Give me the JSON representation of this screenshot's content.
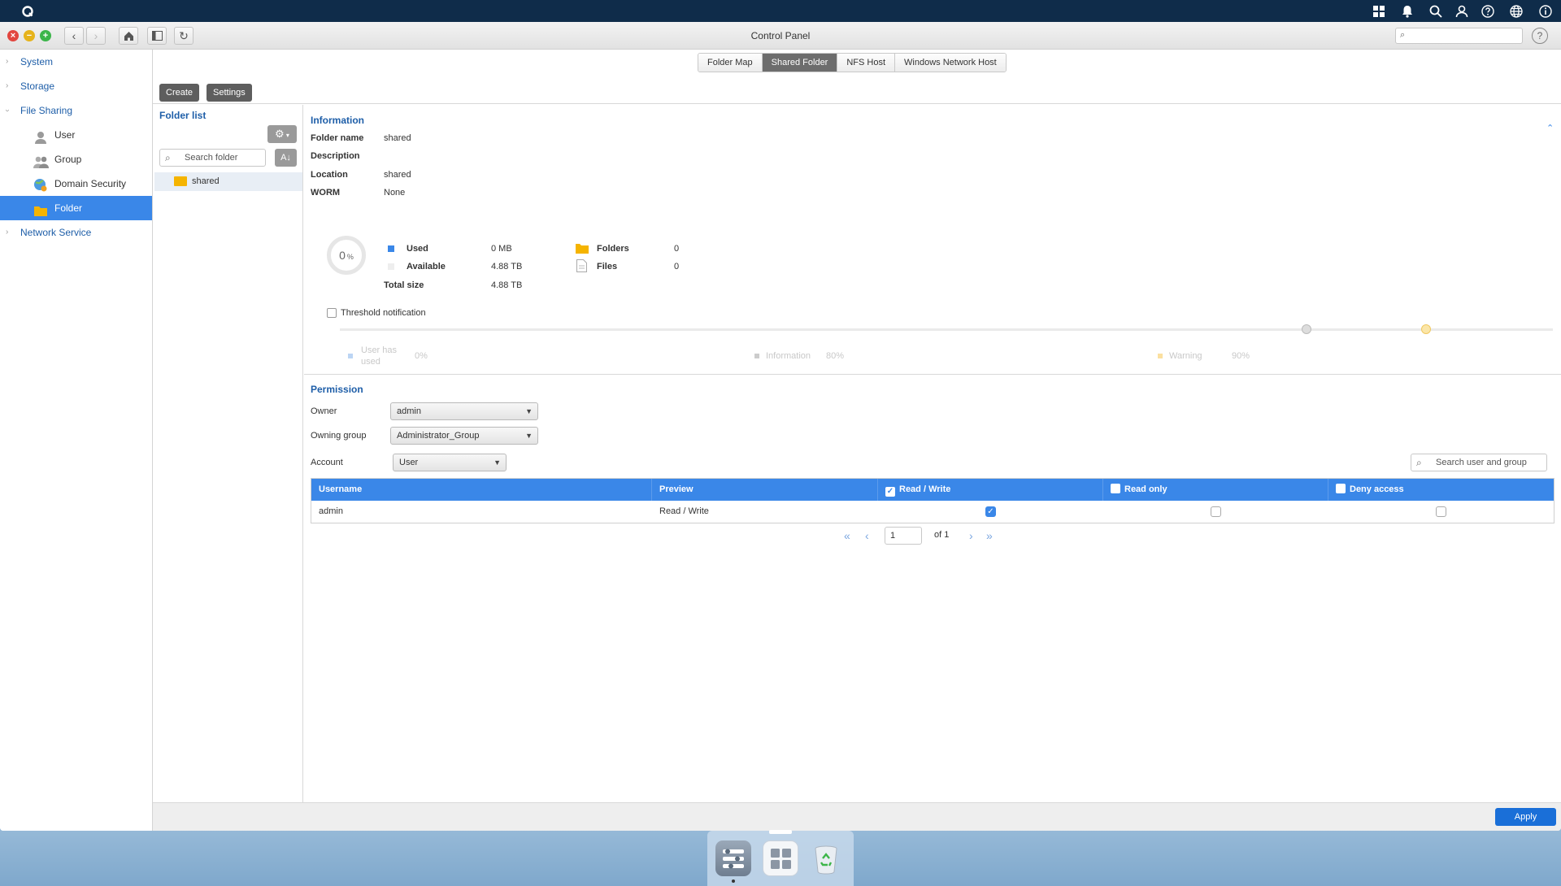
{
  "window": {
    "title": "Control Panel",
    "help_label": "?"
  },
  "sidebar": {
    "items": [
      {
        "label": "System"
      },
      {
        "label": "Storage"
      },
      {
        "label": "File Sharing"
      },
      {
        "label": "User"
      },
      {
        "label": "Group"
      },
      {
        "label": "Domain Security"
      },
      {
        "label": "Folder"
      },
      {
        "label": "Network Service"
      }
    ]
  },
  "tabs": [
    {
      "label": "Folder Map"
    },
    {
      "label": "Shared Folder"
    },
    {
      "label": "NFS Host"
    },
    {
      "label": "Windows Network Host"
    }
  ],
  "toolbar": {
    "create_label": "Create",
    "settings_label": "Settings"
  },
  "folder_panel": {
    "title": "Folder list",
    "search_placeholder": "Search folder",
    "folders": [
      {
        "name": "shared"
      }
    ]
  },
  "information": {
    "title": "Information",
    "fields": [
      {
        "label": "Folder name",
        "value": "shared"
      },
      {
        "label": "Description",
        "value": ""
      },
      {
        "label": "Location",
        "value": "shared"
      },
      {
        "label": "WORM",
        "value": "None"
      }
    ],
    "usage_percent": "0",
    "usage_unit": "%",
    "stats": [
      {
        "label": "Used",
        "value": "0 MB"
      },
      {
        "label": "Available",
        "value": "4.88 TB"
      },
      {
        "label": "Total size",
        "value": "4.88 TB"
      }
    ],
    "counts": [
      {
        "label": "Folders",
        "value": "0"
      },
      {
        "label": "Files",
        "value": "0"
      }
    ],
    "threshold_label": "Threshold notification",
    "threshold_legend": [
      {
        "label": "User has used",
        "value": "0%"
      },
      {
        "label": "Information",
        "value": "80%"
      },
      {
        "label": "Warning",
        "value": "90%"
      }
    ]
  },
  "permission": {
    "title": "Permission",
    "owner_label": "Owner",
    "owner_value": "admin",
    "owning_group_label": "Owning group",
    "owning_group_value": "Administrator_Group",
    "account_label": "Account",
    "account_value": "User",
    "search_placeholder": "Search user and group",
    "columns": [
      "Username",
      "Preview",
      "Read / Write",
      "Read only",
      "Deny access"
    ],
    "rows": [
      {
        "username": "admin",
        "preview": "Read / Write",
        "read_write": true,
        "read_only": false,
        "deny": false
      }
    ],
    "pager": {
      "page": "1",
      "of": "of 1"
    }
  },
  "footer": {
    "apply_label": "Apply"
  },
  "colors": {
    "accent": "#3a87e8",
    "header_bar": "#0f2c4a",
    "folder": "#f5b400",
    "apply": "#1a6fd8"
  }
}
